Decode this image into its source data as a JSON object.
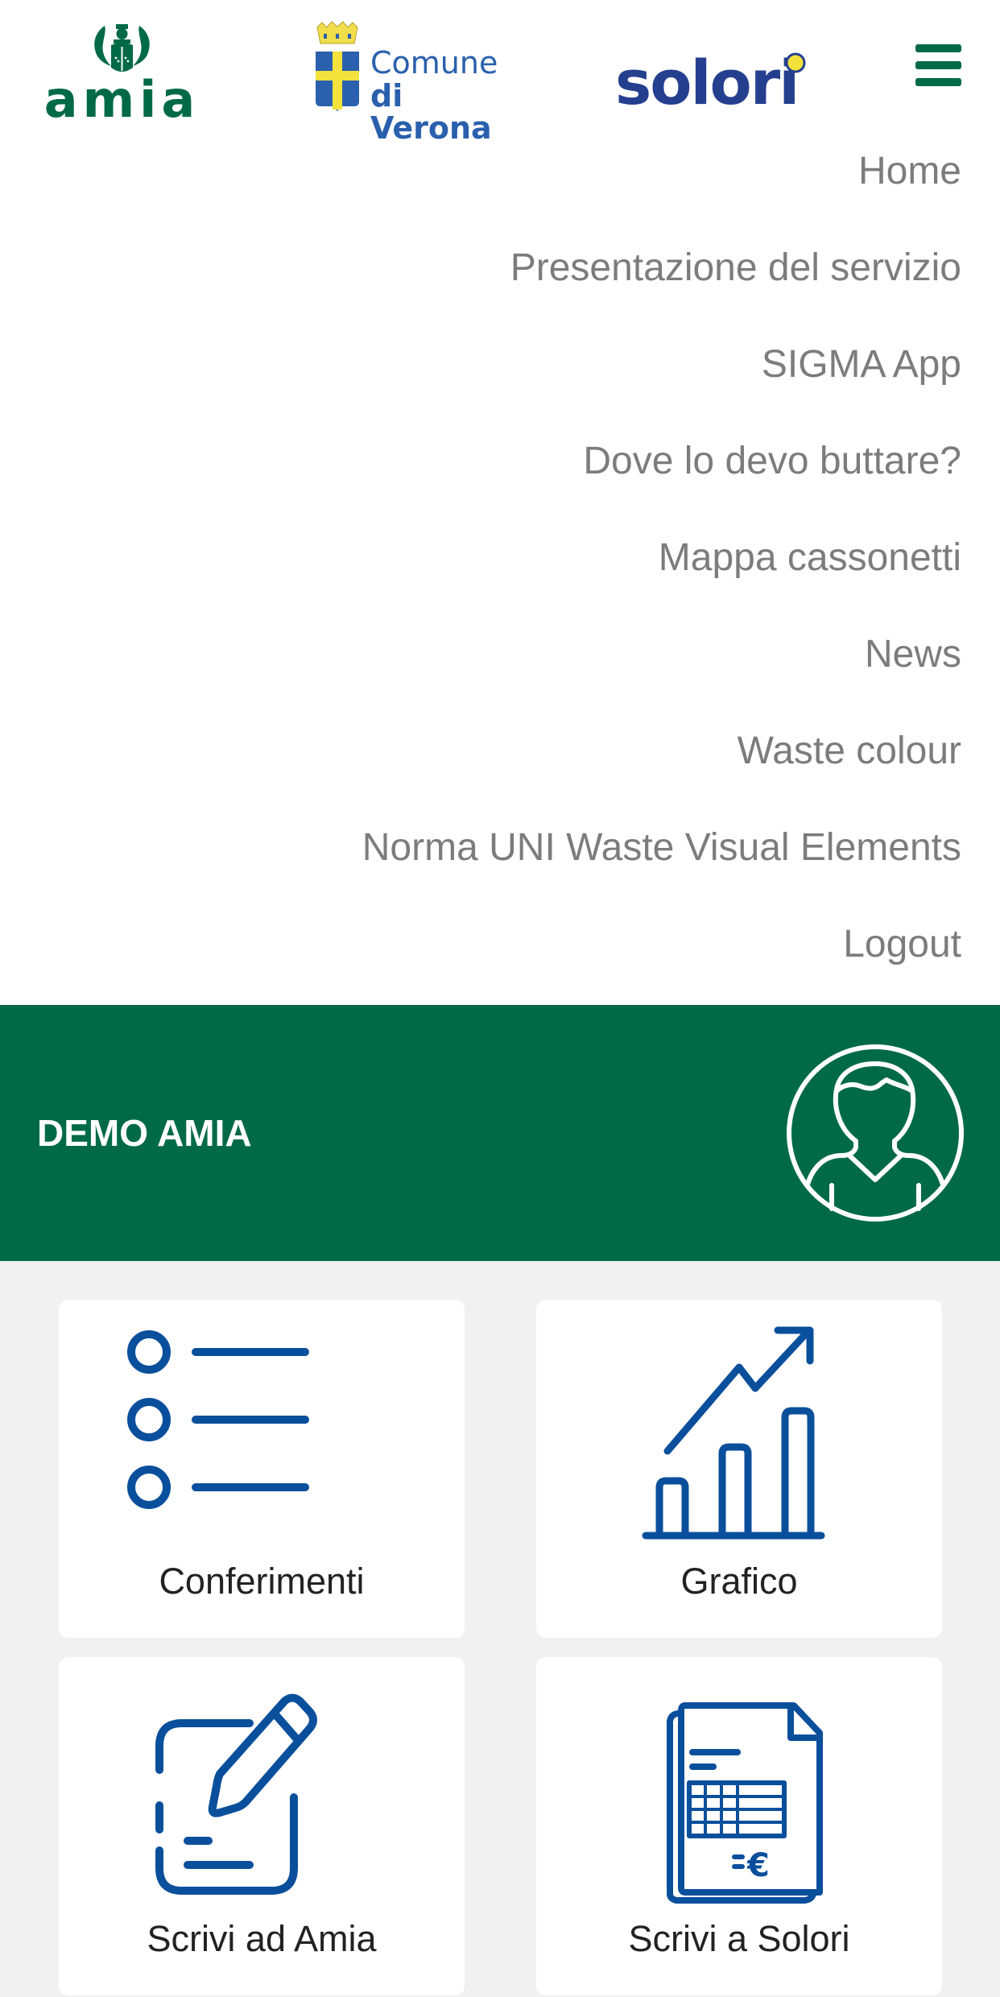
{
  "header": {
    "logos": [
      {
        "name": "amia",
        "text": "amia"
      },
      {
        "name": "comune-di-verona",
        "line1": "Comune",
        "line2": "di Verona"
      },
      {
        "name": "solori",
        "text": "solori"
      }
    ],
    "menu_icon": "hamburger-icon"
  },
  "menu": {
    "items": [
      {
        "label": "Home"
      },
      {
        "label": "Presentazione del servizio"
      },
      {
        "label": "SIGMA App"
      },
      {
        "label": "Dove lo devo buttare?"
      },
      {
        "label": "Mappa cassonetti"
      },
      {
        "label": "News"
      },
      {
        "label": "Waste colour"
      },
      {
        "label": "Norma UNI Waste Visual Elements"
      },
      {
        "label": "Logout"
      }
    ]
  },
  "user": {
    "name": "DEMO AMIA",
    "avatar_icon": "user-avatar-icon"
  },
  "tiles": [
    {
      "label": "Conferimenti",
      "icon": "list-icon"
    },
    {
      "label": "Grafico",
      "icon": "growth-chart-icon"
    },
    {
      "label": "Scrivi ad Amia",
      "icon": "edit-note-icon"
    },
    {
      "label": "Scrivi a Solori",
      "icon": "invoice-euro-icon"
    }
  ],
  "colors": {
    "brand_green": "#006a46",
    "icon_blue": "#0a4f9c",
    "menu_text": "#7c7c7c",
    "background": "#f1f1f1",
    "verona_blue": "#2a60ad",
    "solori_blue": "#253f8f",
    "solori_yellow": "#f3e23b"
  }
}
